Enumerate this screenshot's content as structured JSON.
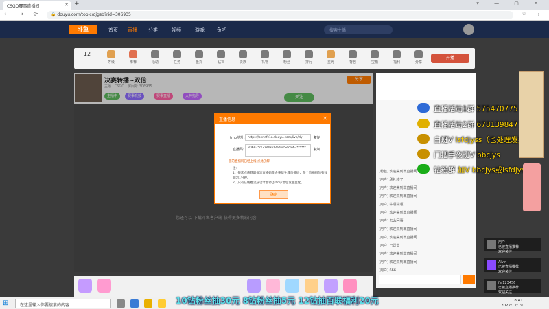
{
  "browser": {
    "tab_title": "CSGO赛事直播间",
    "url": "douyu.com/topic/djgsb?rid=306935"
  },
  "header": {
    "logo": "斗鱼",
    "nav": [
      "首页",
      "直播",
      "分类",
      "视频",
      "游戏",
      "鱼吧"
    ],
    "search_placeholder": "搜索主播"
  },
  "featbar": {
    "room_num": "12",
    "items": [
      "等级",
      "推荐",
      "活动",
      "任务",
      "鱼丸",
      "钻石",
      "贵族",
      "礼物",
      "粉丝",
      "排行",
      "星光",
      "背包",
      "宝箱",
      "福利",
      "分享"
    ],
    "right_button": "开播"
  },
  "stream": {
    "title": "决赛转播~双倍",
    "meta": "主播 · CSGO · 房间号 306935",
    "tags": [
      {
        "label": "主播中",
        "color": "#5cb85c"
      },
      {
        "label": "赛事竞技",
        "color": "#8e6cff"
      },
      {
        "label": "赛事直播",
        "color": "#ff5fa2"
      },
      {
        "label": "大神指导",
        "color": "#c267ff"
      }
    ],
    "follow_label": "关注",
    "right_btn": "分享",
    "offline_text": "您还可以 下载斗鱼客户端 获得更多精彩内容"
  },
  "dialog": {
    "title": "直播信息",
    "rtmp_label": "rtmp地址:",
    "rtmp_value": "https://sendfc1a.douyu.com/live/dy",
    "code_label": "直播码:",
    "code_value": "306935rsZWzN5fRa?wsSecret=******",
    "copy_label": "复制",
    "warn": "您的直播码已经上线   点此了解",
    "notes": [
      "注:",
      "1、每次点击获取推流直播码都会重新生成直播码，每个直播码的有效期为1分钟。",
      "2、只有在线推流成功才会停止rtmp地址发生变化。"
    ],
    "ok_label": "确定"
  },
  "chat": {
    "lines": [
      "[粉丝] 欢迎来到本直播间",
      "[用户] 刷礼物了",
      "[用户] 欢迎来到本直播间",
      "[用户] 欢迎来到本直播间",
      "[用户] 牛逼牛逼",
      "[用户] 欢迎来到本直播间",
      "[用户] 怎么回事",
      "[用户] 欢迎来到本直播间",
      "[用户] 欢迎来到本直播间",
      "[用户] 已送出",
      "[用户] 欢迎来到本直播间",
      "[用户] 欢迎来到本直播间",
      "[用户] 666"
    ]
  },
  "overlay": [
    {
      "text": "直播活动1群 ",
      "hl": "575470775",
      "color": "#2e6ad6"
    },
    {
      "text": "直播活动2群 ",
      "hl": "678139847",
      "color": "#e0b000"
    },
    {
      "text": "白班V ",
      "hl": "lsfdjyss（也处理发奖问题）",
      "color": "#c89000"
    },
    {
      "text": "门把手夜班V   ",
      "hl": "bbcjys",
      "color": "#c89000"
    },
    {
      "text": "钻粉群  ",
      "hl": "加V bbcjys或lsfdjyss",
      "color": "#1aad19"
    }
  ],
  "notifications": [
    {
      "name": "用户",
      "line1": "已被直播推荐",
      "line2": "欢迎关注"
    },
    {
      "name": "Alvin",
      "line1": "已被直播推荐",
      "line2": "欢迎关注"
    },
    {
      "name": "fal123456",
      "line1": "已被直播推荐",
      "line2": "欢迎关注"
    }
  ],
  "taskbar": {
    "search_placeholder": "在这里输入你要搜索的内容",
    "time": "18:41",
    "date": "2022/12/19"
  },
  "marquee": "10钻粉丝抽30元  8钻粉丝抽5元  12钻抽百联福利20元"
}
